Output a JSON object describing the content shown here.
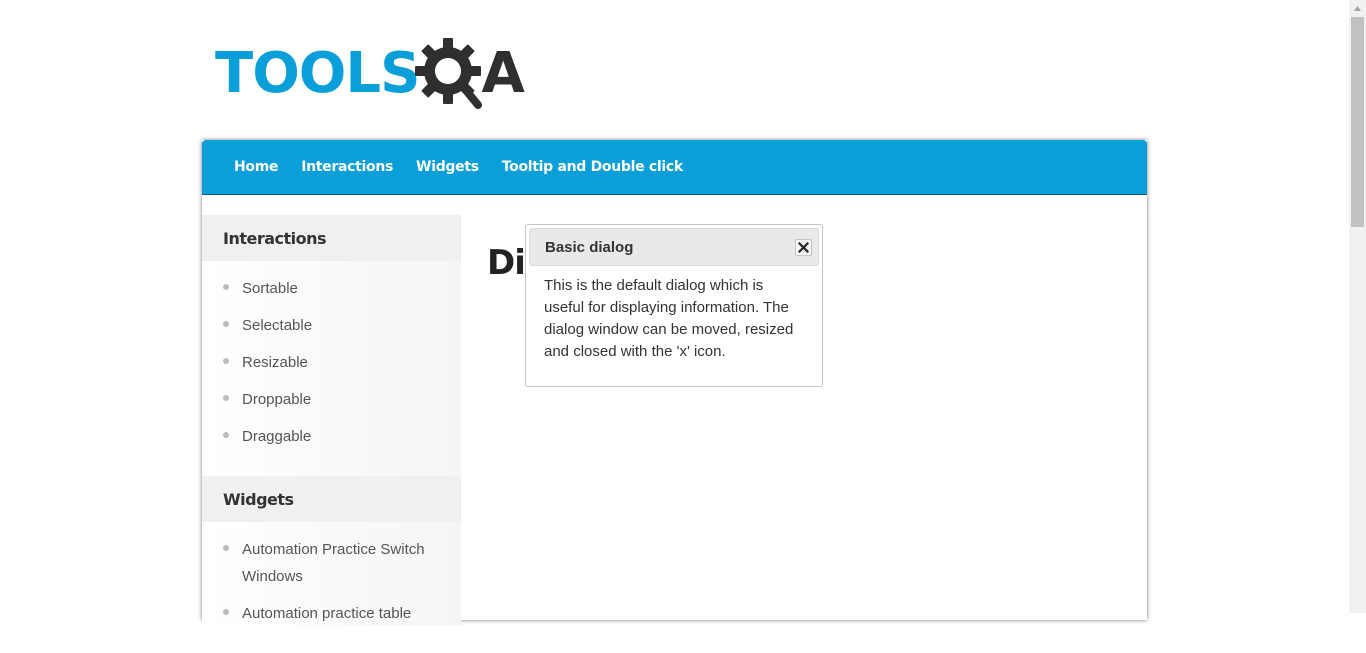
{
  "logo": {
    "part1": "TOOLS",
    "part2": "A"
  },
  "nav": {
    "items": [
      "Home",
      "Interactions",
      "Widgets",
      "Tooltip and Double click"
    ]
  },
  "sidebar": {
    "sections": [
      {
        "title": "Interactions",
        "items": [
          "Sortable",
          "Selectable",
          "Resizable",
          "Droppable",
          "Draggable"
        ]
      },
      {
        "title": "Widgets",
        "items": [
          "Automation Practice Switch Windows",
          "Automation practice table"
        ]
      }
    ]
  },
  "main": {
    "title": "Dialog"
  },
  "dialog": {
    "title": "Basic dialog",
    "body": "This is the default dialog which is useful for displaying information. The dialog window can be moved, resized and closed with the 'x' icon."
  },
  "colors": {
    "brand_blue": "#0a9fd8",
    "dark": "#2f2f2f"
  }
}
